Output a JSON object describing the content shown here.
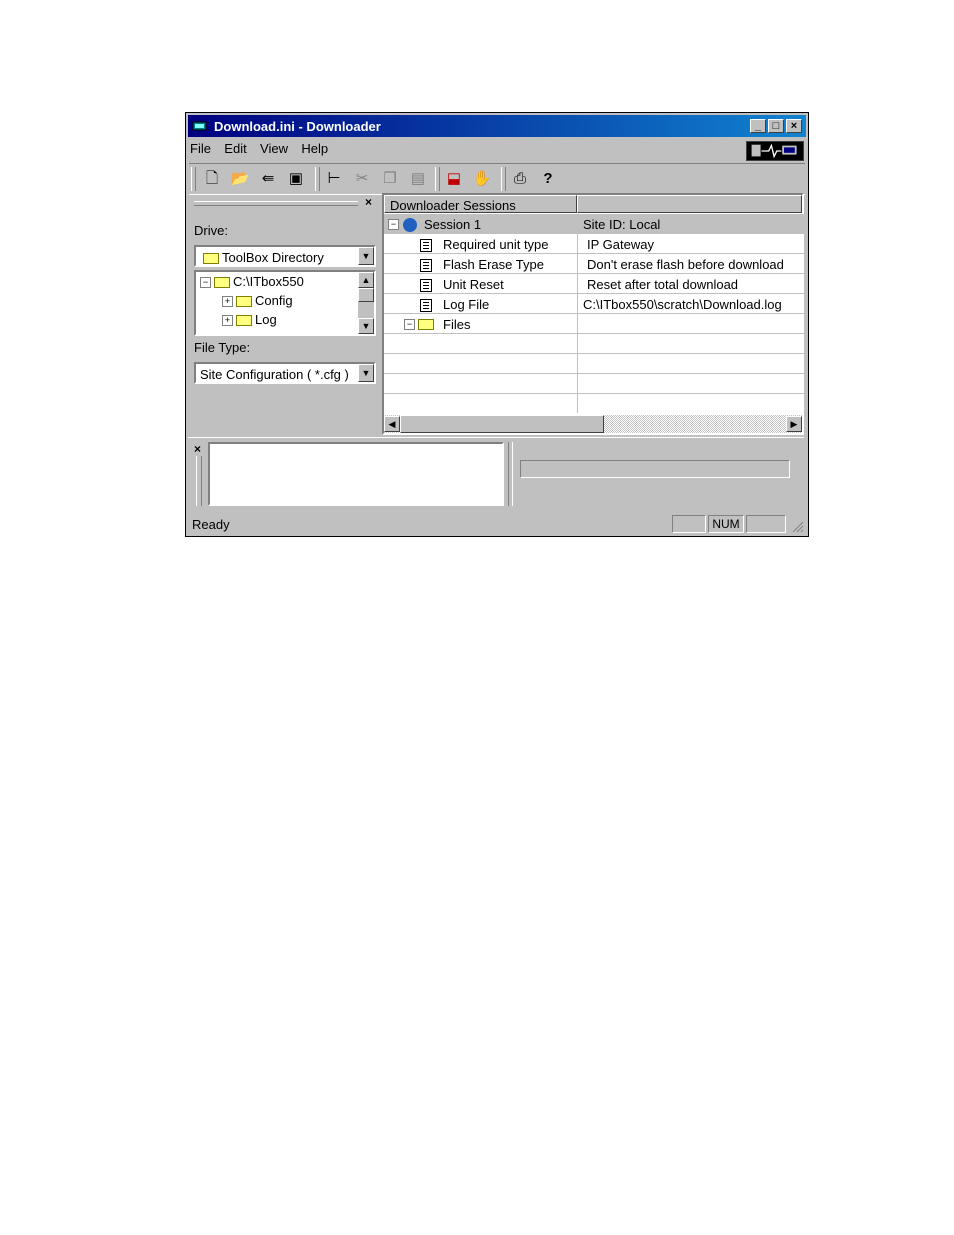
{
  "window": {
    "title": "Download.ini - Downloader"
  },
  "menu": [
    "File",
    "Edit",
    "View",
    "Help"
  ],
  "toolbar": {
    "icons": [
      "new-file-icon",
      "open-folder-icon",
      "exit-door-icon",
      "save-disk-icon",
      "tree-view-icon",
      "cut-icon",
      "copy-icon",
      "paste-icon",
      "download-icon",
      "stop-hand-icon",
      "print-icon",
      "help-icon"
    ]
  },
  "left_pane": {
    "drive_label": "Drive:",
    "drive_value": "ToolBox Directory",
    "tree": [
      "C:\\ITbox550",
      "Config",
      "Log"
    ],
    "filetype_label": "File Type:",
    "filetype_value": "Site Configuration ( *.cfg )"
  },
  "sessions": {
    "header": "Downloader Sessions",
    "rows": [
      {
        "name": "Session 1",
        "value": "Site ID:  Local"
      },
      {
        "name": "Required unit type",
        "value": "IP Gateway"
      },
      {
        "name": "Flash Erase Type",
        "value": "Don't erase flash before download"
      },
      {
        "name": "Unit Reset",
        "value": "Reset after total download"
      },
      {
        "name": "Log File",
        "value": "C:\\ITbox550\\scratch\\Download.log"
      },
      {
        "name": "Files",
        "value": ""
      }
    ]
  },
  "status": {
    "text": "Ready",
    "num": "NUM"
  },
  "colors": {
    "titlebar": "#000080",
    "face": "#c0c0c0"
  }
}
